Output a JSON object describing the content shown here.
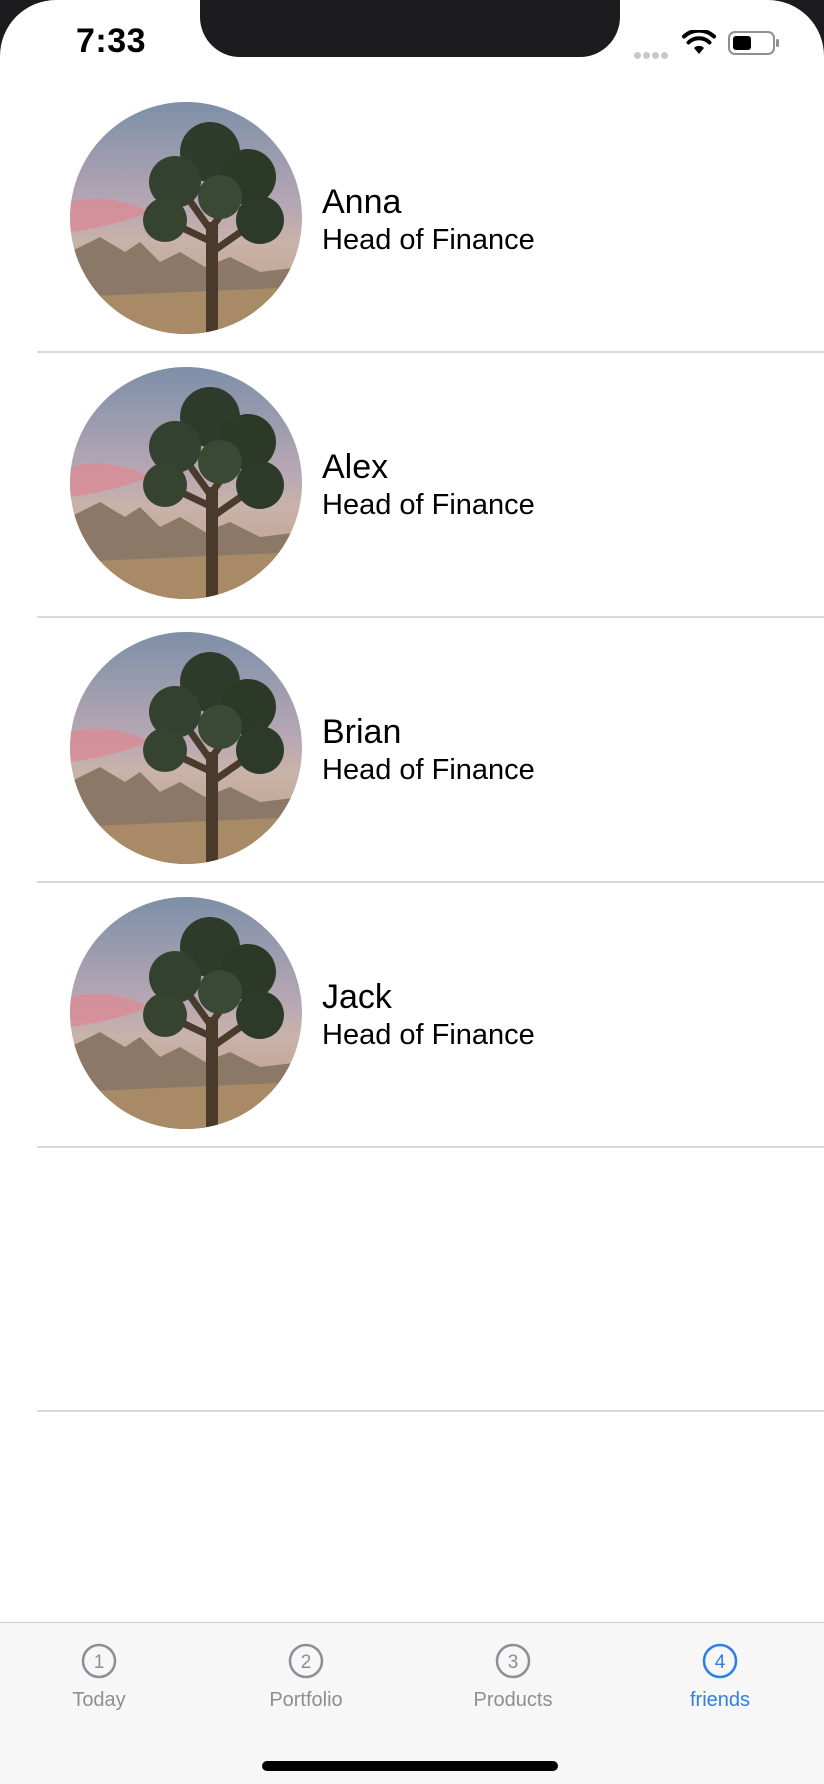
{
  "status_bar": {
    "time": "7:33"
  },
  "friends": [
    {
      "name": "Anna",
      "role": "Head of Finance"
    },
    {
      "name": "Alex",
      "role": "Head of Finance"
    },
    {
      "name": "Brian",
      "role": "Head of Finance"
    },
    {
      "name": "Jack",
      "role": "Head of Finance"
    }
  ],
  "tab_bar": {
    "items": [
      {
        "number": "1",
        "label": "Today",
        "active": false
      },
      {
        "number": "2",
        "label": "Portfolio",
        "active": false
      },
      {
        "number": "3",
        "label": "Products",
        "active": false
      },
      {
        "number": "4",
        "label": "friends",
        "active": true
      }
    ],
    "active_color": "#2f7ee8",
    "inactive_color": "#8e8e93"
  },
  "avatar_icon": "joshua-tree-photo"
}
